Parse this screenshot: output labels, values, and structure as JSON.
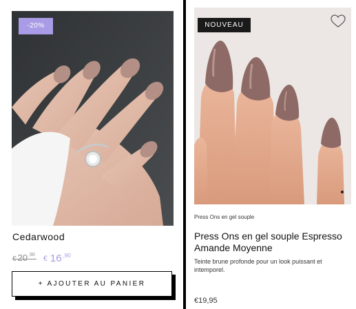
{
  "left_product": {
    "discount_badge": "-20%",
    "title": "Cedarwood",
    "old_price": {
      "currency": "€",
      "integer": "20",
      "decimal": ",90"
    },
    "new_price": {
      "currency": "€",
      "integer": "16",
      "decimal": ",90"
    },
    "add_to_cart_label": "+ AJOUTER AU PANIER",
    "image_icon": "hand-with-nails-photo"
  },
  "right_product": {
    "new_badge": "NOUVEAU",
    "favorite_icon": "heart-icon",
    "category": "Press Ons en gel souple",
    "title": "Press Ons en gel souple Espresso Amande Moyenne",
    "description": "Teinte brune profonde pour un look puissant et intemporel.",
    "price": "€19,95",
    "image_icon": "hand-with-almond-nails-photo"
  },
  "colors": {
    "accent": "#a99be6",
    "badge_dark": "#1a1a1a",
    "nail_left": "#b48f85",
    "nail_right": "#8e6a66"
  }
}
